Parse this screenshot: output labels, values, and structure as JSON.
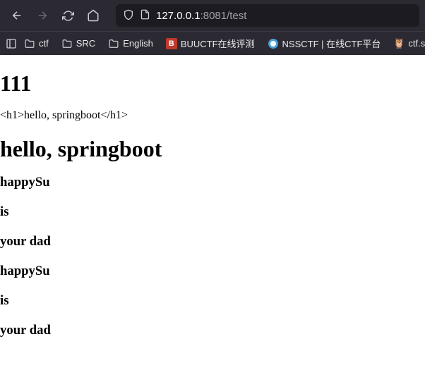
{
  "url": {
    "host": "127.0.0.1",
    "port_path": ":8081/test"
  },
  "bookmarks": {
    "folders": [
      "ctf",
      "SRC",
      "English"
    ],
    "links": [
      {
        "label": "BUUCTF在线评测",
        "favicon": "red"
      },
      {
        "label": "NSSCTF | 在线CTF平台",
        "favicon": "nss"
      },
      {
        "label": "ctf.sho",
        "favicon": "owl"
      }
    ]
  },
  "page": {
    "h1_111": "111",
    "escaped_line": "<h1>hello, springboot</h1>",
    "h1_hello": "hello, springboot",
    "lines": [
      "happySu",
      "is",
      "your dad",
      "happySu",
      "is",
      "your dad"
    ]
  }
}
